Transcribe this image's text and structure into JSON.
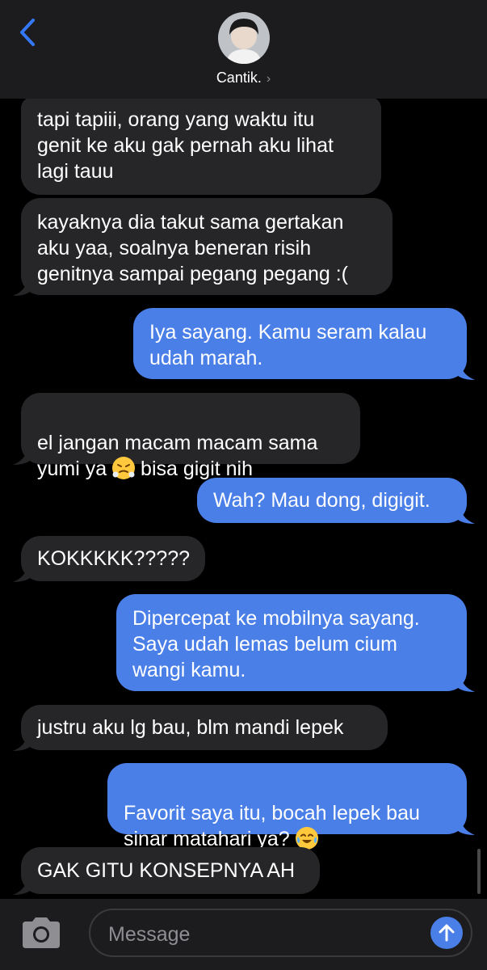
{
  "header": {
    "contact_name": "Cantik.",
    "chevron": "›",
    "icons": {
      "back": "chevron-left-icon",
      "avatar": "contact-avatar"
    }
  },
  "messages": [
    {
      "side": "received",
      "text": "tapi tapiii, orang yang waktu itu\ngenit ke aku gak pernah aku lihat\nlagi tauu"
    },
    {
      "side": "received",
      "text": "kayaknya dia takut sama gertakan\naku yaa, soalnya beneran risih\ngenitnya sampai pegang pegang :("
    },
    {
      "side": "sent",
      "text": "Iya sayang. Kamu seram kalau\nudah marah."
    },
    {
      "side": "received",
      "text_before": "el jangan macam macam sama\nyumi ya ",
      "emoji": "steam-from-nose-emoji",
      "text_after": " bisa gigit nih"
    },
    {
      "side": "sent",
      "text": "Wah? Mau dong, digigit."
    },
    {
      "side": "received",
      "text": "KOKKKKK?????"
    },
    {
      "side": "sent",
      "text": "Dipercepat ke mobilnya sayang.\nSaya udah lemas belum cium\nwangi kamu."
    },
    {
      "side": "received",
      "text": "justru aku lg bau, blm mandi lepek"
    },
    {
      "side": "sent",
      "text_before": "Favorit saya itu, bocah lepek bau\nsinar matahari ya? ",
      "emoji": "tears-of-joy-emoji",
      "text_after": ""
    },
    {
      "side": "received",
      "text": "GAK GITU KONSEPNYA AH"
    }
  ],
  "composer": {
    "placeholder": "Message",
    "value": "",
    "icons": {
      "camera": "camera-icon",
      "send": "send-arrow-icon"
    }
  },
  "colors": {
    "background": "#000000",
    "received_bubble": "#262628",
    "sent_bubble": "#4a7fe8",
    "bar": "#1c1c1e",
    "accent": "#3478f6"
  }
}
